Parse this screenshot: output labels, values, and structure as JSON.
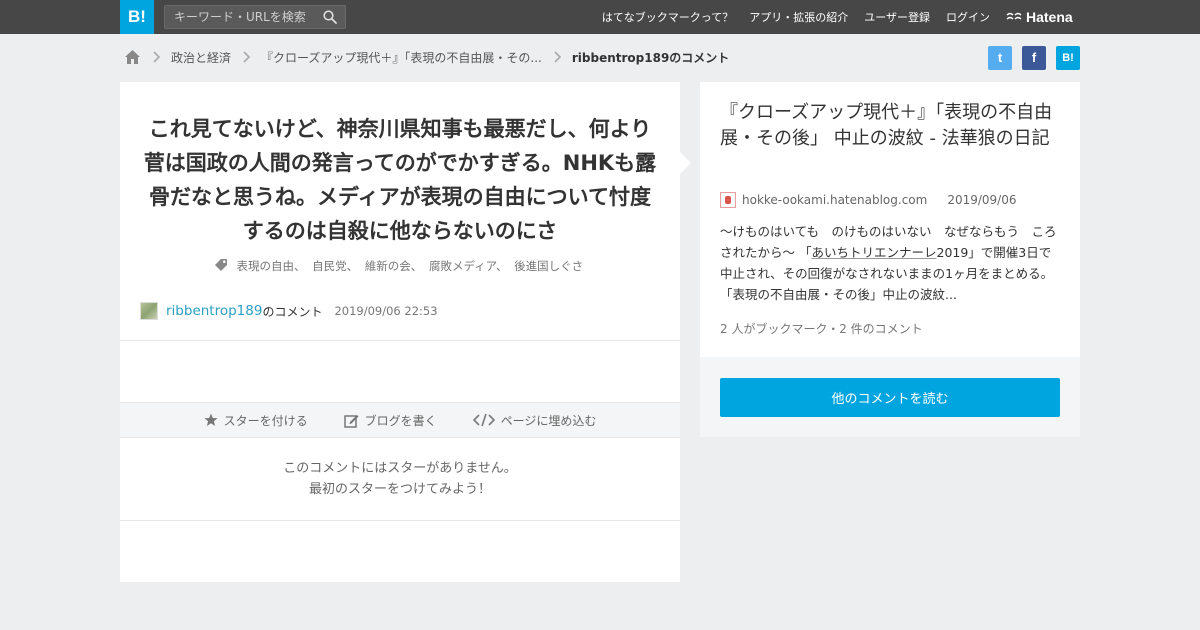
{
  "topbar": {
    "logo": "B!",
    "search_placeholder": "キーワード・URLを検索",
    "nav": [
      "はてなブックマークって？",
      "アプリ・拡張の紹介",
      "ユーザー登録",
      "ログイン"
    ],
    "brand": "Hatena"
  },
  "breadcrumb": {
    "items": [
      "政治と経済",
      "『クローズアップ現代＋』「表現の不自由展・その...",
      "ribbentrop189のコメント"
    ]
  },
  "share": {
    "twitter": "t",
    "facebook": "f",
    "hatena": "B!"
  },
  "comment": {
    "text": "これ見てないけど、神奈川県知事も最悪だし、何より菅は国政の人間の発言ってのがでかすぎる。NHKも露骨だなと思うね。メディアが表現の自由について忖度するのは自殺に他ならないのにさ",
    "tags": [
      "表現の自由、",
      "自民党、",
      "維新の会、",
      "腐敗メディア、",
      "後進国しぐさ"
    ],
    "author": "ribbentrop189",
    "author_suffix": "のコメント",
    "date": "2019/09/06 22:53"
  },
  "actions": {
    "star": "スターを付ける",
    "blog": "ブログを書く",
    "embed": "ページに埋め込む"
  },
  "no_star": {
    "line1": "このコメントにはスターがありません。",
    "line2": "最初のスターをつけてみよう！"
  },
  "entry": {
    "title": "『クローズアップ現代＋』「表現の不自由展・その後」 中止の波紋 - 法華狼の日記",
    "domain": "hokke-ookami.hatenablog.com",
    "date": "2019/09/06",
    "summary_before": "～けものはいても　のけものはいない　なぜならもう　ころされたから～ 「",
    "summary_link": "あいちトリエンナーレ",
    "summary_after": "2019」で開催3日で中止され、その回復がなされないままの1ヶ月をまとめる。「表現の不自由展・その後」中止の波紋...",
    "counts": "2 人がブックマーク・2 件のコメント",
    "button": "他のコメントを読む"
  },
  "colors": {
    "brand": "#00a4de",
    "topbar": "#474747",
    "link": "#29a0c4"
  }
}
